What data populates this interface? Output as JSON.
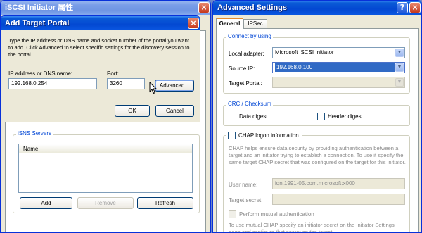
{
  "initiator_window": {
    "title": "iSCSI Initiator 属性",
    "isns_group_title": "iSNS Servers",
    "isns_column": "Name",
    "add_label": "Add",
    "remove_label": "Remove",
    "refresh_label": "Refresh"
  },
  "add_portal_dialog": {
    "title": "Add Target Portal",
    "instructions": "Type the IP address or DNS name and socket number of the portal you want to add. Click Advanced to select specific settings for the discovery session to the portal.",
    "ip_label": "IP address or DNS name:",
    "ip_value": "192.168.0.254",
    "port_label": "Port:",
    "port_value": "3260",
    "advanced_label": "Advanced...",
    "ok_label": "OK",
    "cancel_label": "Cancel"
  },
  "advanced_window": {
    "title": "Advanced Settings",
    "help_glyph": "?",
    "close_glyph": "×",
    "tabs": [
      "General",
      "IPSec"
    ],
    "connect_group_title": "Connect by using",
    "local_adapter_label": "Local adapter:",
    "local_adapter_value": "Microsoft iSCSI Initiator",
    "source_ip_label": "Source IP:",
    "source_ip_value": "192.168.0.100",
    "target_portal_label": "Target Portal:",
    "target_portal_value": "",
    "crc_group_title": "CRC / Checksum",
    "data_digest_label": "Data digest",
    "header_digest_label": "Header digest",
    "chap_label": "CHAP logon information",
    "chap_help": "CHAP helps ensure data security by providing authentication between a target and an initiator trying to establish a connection. To use it specify the same target CHAP secret that was configured on the target for this initiator.",
    "user_name_label": "User name:",
    "user_name_value": "iqn.1991-05.com.microsoft:x000",
    "target_secret_label": "Target secret:",
    "target_secret_value": "",
    "mutual_auth_label": "Perform mutual authentication",
    "mutual_help": "To use mutual CHAP specify an initiator secret on the Initiator Settings page and configure that secret on the target."
  },
  "colors": {
    "xp_blue": "#0348d2",
    "group_title": "#0046d5",
    "selection": "#316ac5",
    "dialog_face": "#ece9d8"
  }
}
